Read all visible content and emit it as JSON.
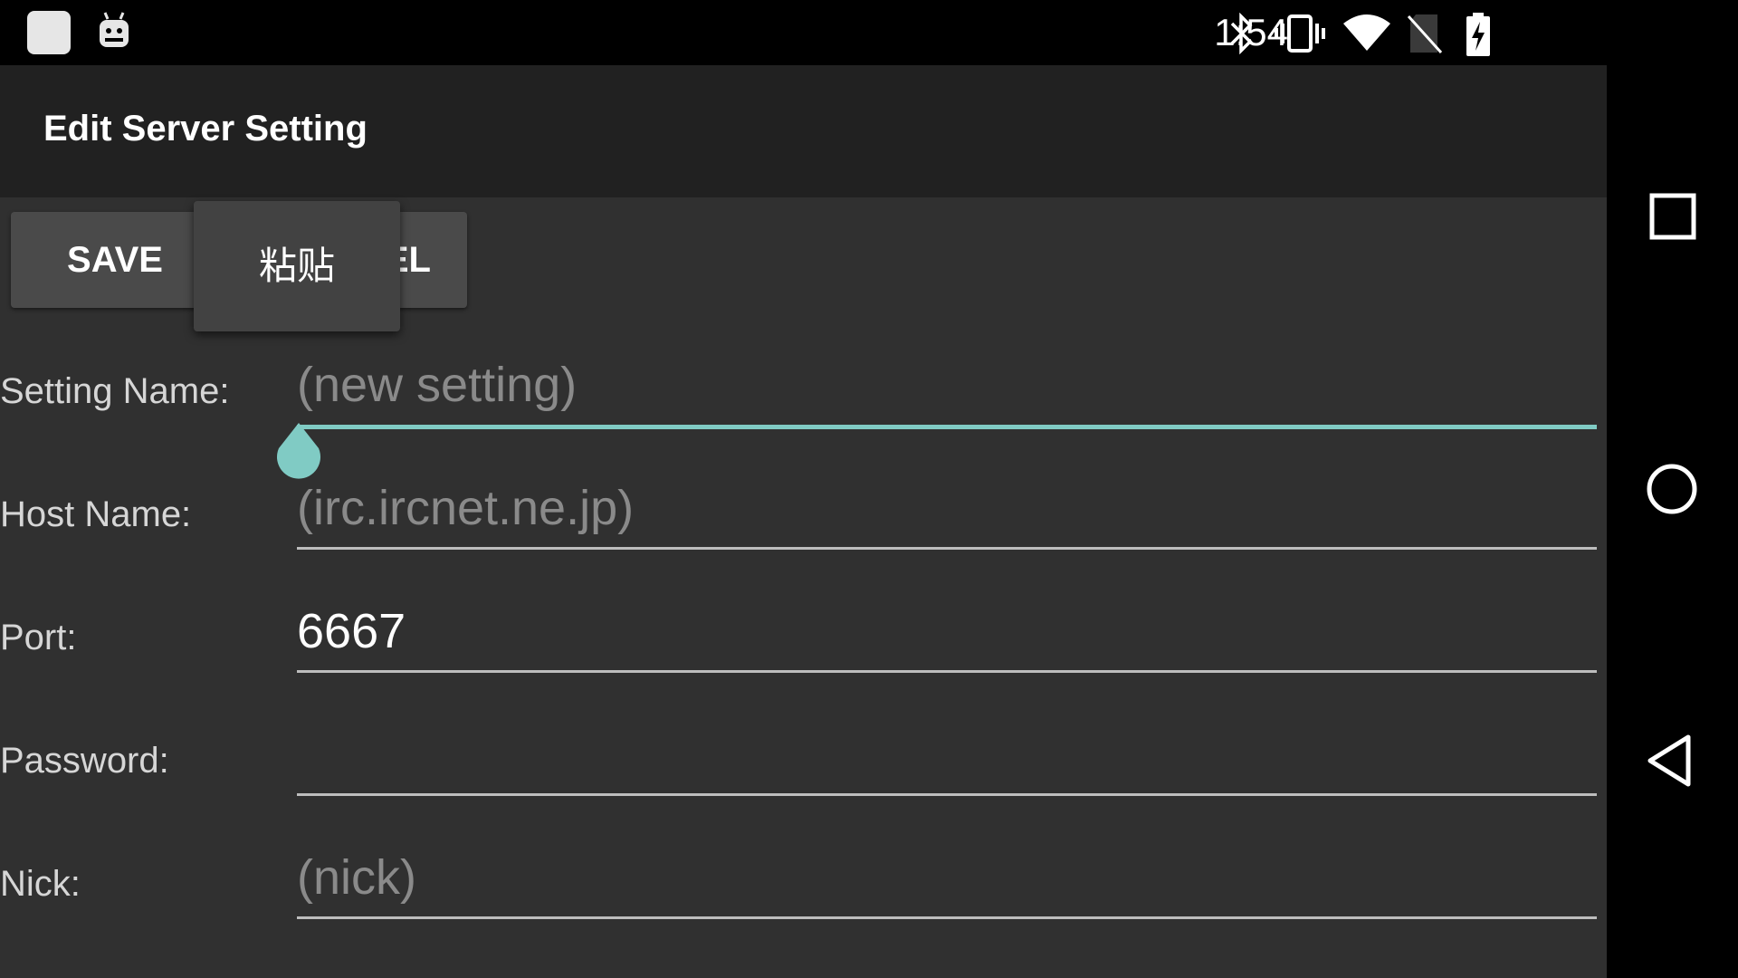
{
  "status_bar": {
    "time": "1:54",
    "icons": [
      "notification-square-icon",
      "android-robot-icon",
      "bluetooth-icon",
      "vibrate-icon",
      "wifi-icon",
      "no-sim-icon",
      "battery-charging-icon"
    ]
  },
  "action_bar": {
    "title": "Edit Server Setting"
  },
  "buttons": {
    "save": "SAVE",
    "cancel_visible": "EL"
  },
  "context_popup": {
    "paste": "粘贴"
  },
  "form": {
    "setting_name": {
      "label": "Setting Name:",
      "placeholder": "(new setting)"
    },
    "host_name": {
      "label": "Host Name:",
      "placeholder": "(irc.ircnet.ne.jp)"
    },
    "port": {
      "label": "Port:",
      "value": "6667"
    },
    "password": {
      "label": "Password:",
      "value": ""
    },
    "nick": {
      "label": "Nick:",
      "placeholder": "(nick)"
    }
  },
  "colors": {
    "accent": "#80cbc4",
    "background": "#303030",
    "action_bar": "#212121"
  },
  "nav_bar": {
    "buttons": [
      "recents-square-icon",
      "home-circle-icon",
      "back-triangle-icon"
    ]
  }
}
